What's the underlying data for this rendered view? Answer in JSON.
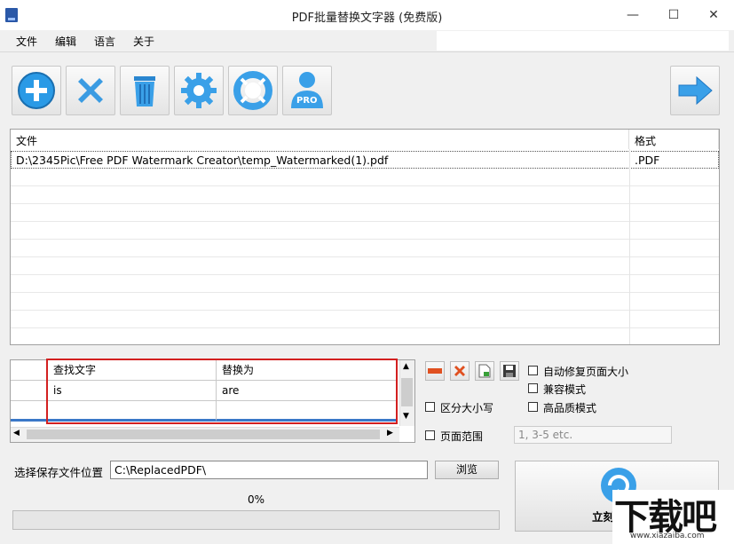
{
  "window": {
    "title": "PDF批量替换文字器 (免费版)"
  },
  "menu": [
    "文件",
    "编辑",
    "语言",
    "关于"
  ],
  "toolbar": {
    "add_icon": "add-icon",
    "remove_icon": "remove-icon",
    "clear_icon": "trash-icon",
    "settings_icon": "gear-icon",
    "help_icon": "lifebuoy-icon",
    "pro_icon": "pro-user-icon",
    "pro_label": "PRO",
    "next_icon": "arrow-right-icon"
  },
  "file_list": {
    "columns": [
      "文件",
      "格式"
    ],
    "rows": [
      {
        "file": "D:\\2345Pic\\Free PDF Watermark Creator\\temp_Watermarked(1).pdf",
        "format": ".PDF"
      }
    ]
  },
  "replace_grid": {
    "columns": [
      "查找文字",
      "替换为"
    ],
    "rows": [
      {
        "find": "is",
        "replace": "are"
      },
      {
        "find": "",
        "replace": ""
      }
    ]
  },
  "options": {
    "auto_fix_page_size": "自动修复页面大小",
    "compat_mode": "兼容模式",
    "high_quality": "高品质模式",
    "case_sensitive": "区分大小写",
    "page_range": "页面范围",
    "page_range_placeholder": "1, 3-5 etc."
  },
  "save": {
    "label": "选择保存文件位置",
    "path": "C:\\ReplacedPDF\\",
    "browse": "浏览"
  },
  "progress": {
    "text": "0%",
    "value": 0
  },
  "start": {
    "label": "立刻"
  },
  "watermark": {
    "text": "下载吧",
    "url": "www.xiazaiba.com"
  },
  "colors": {
    "accent": "#3aa0e8",
    "highlight_border": "#d32020"
  }
}
